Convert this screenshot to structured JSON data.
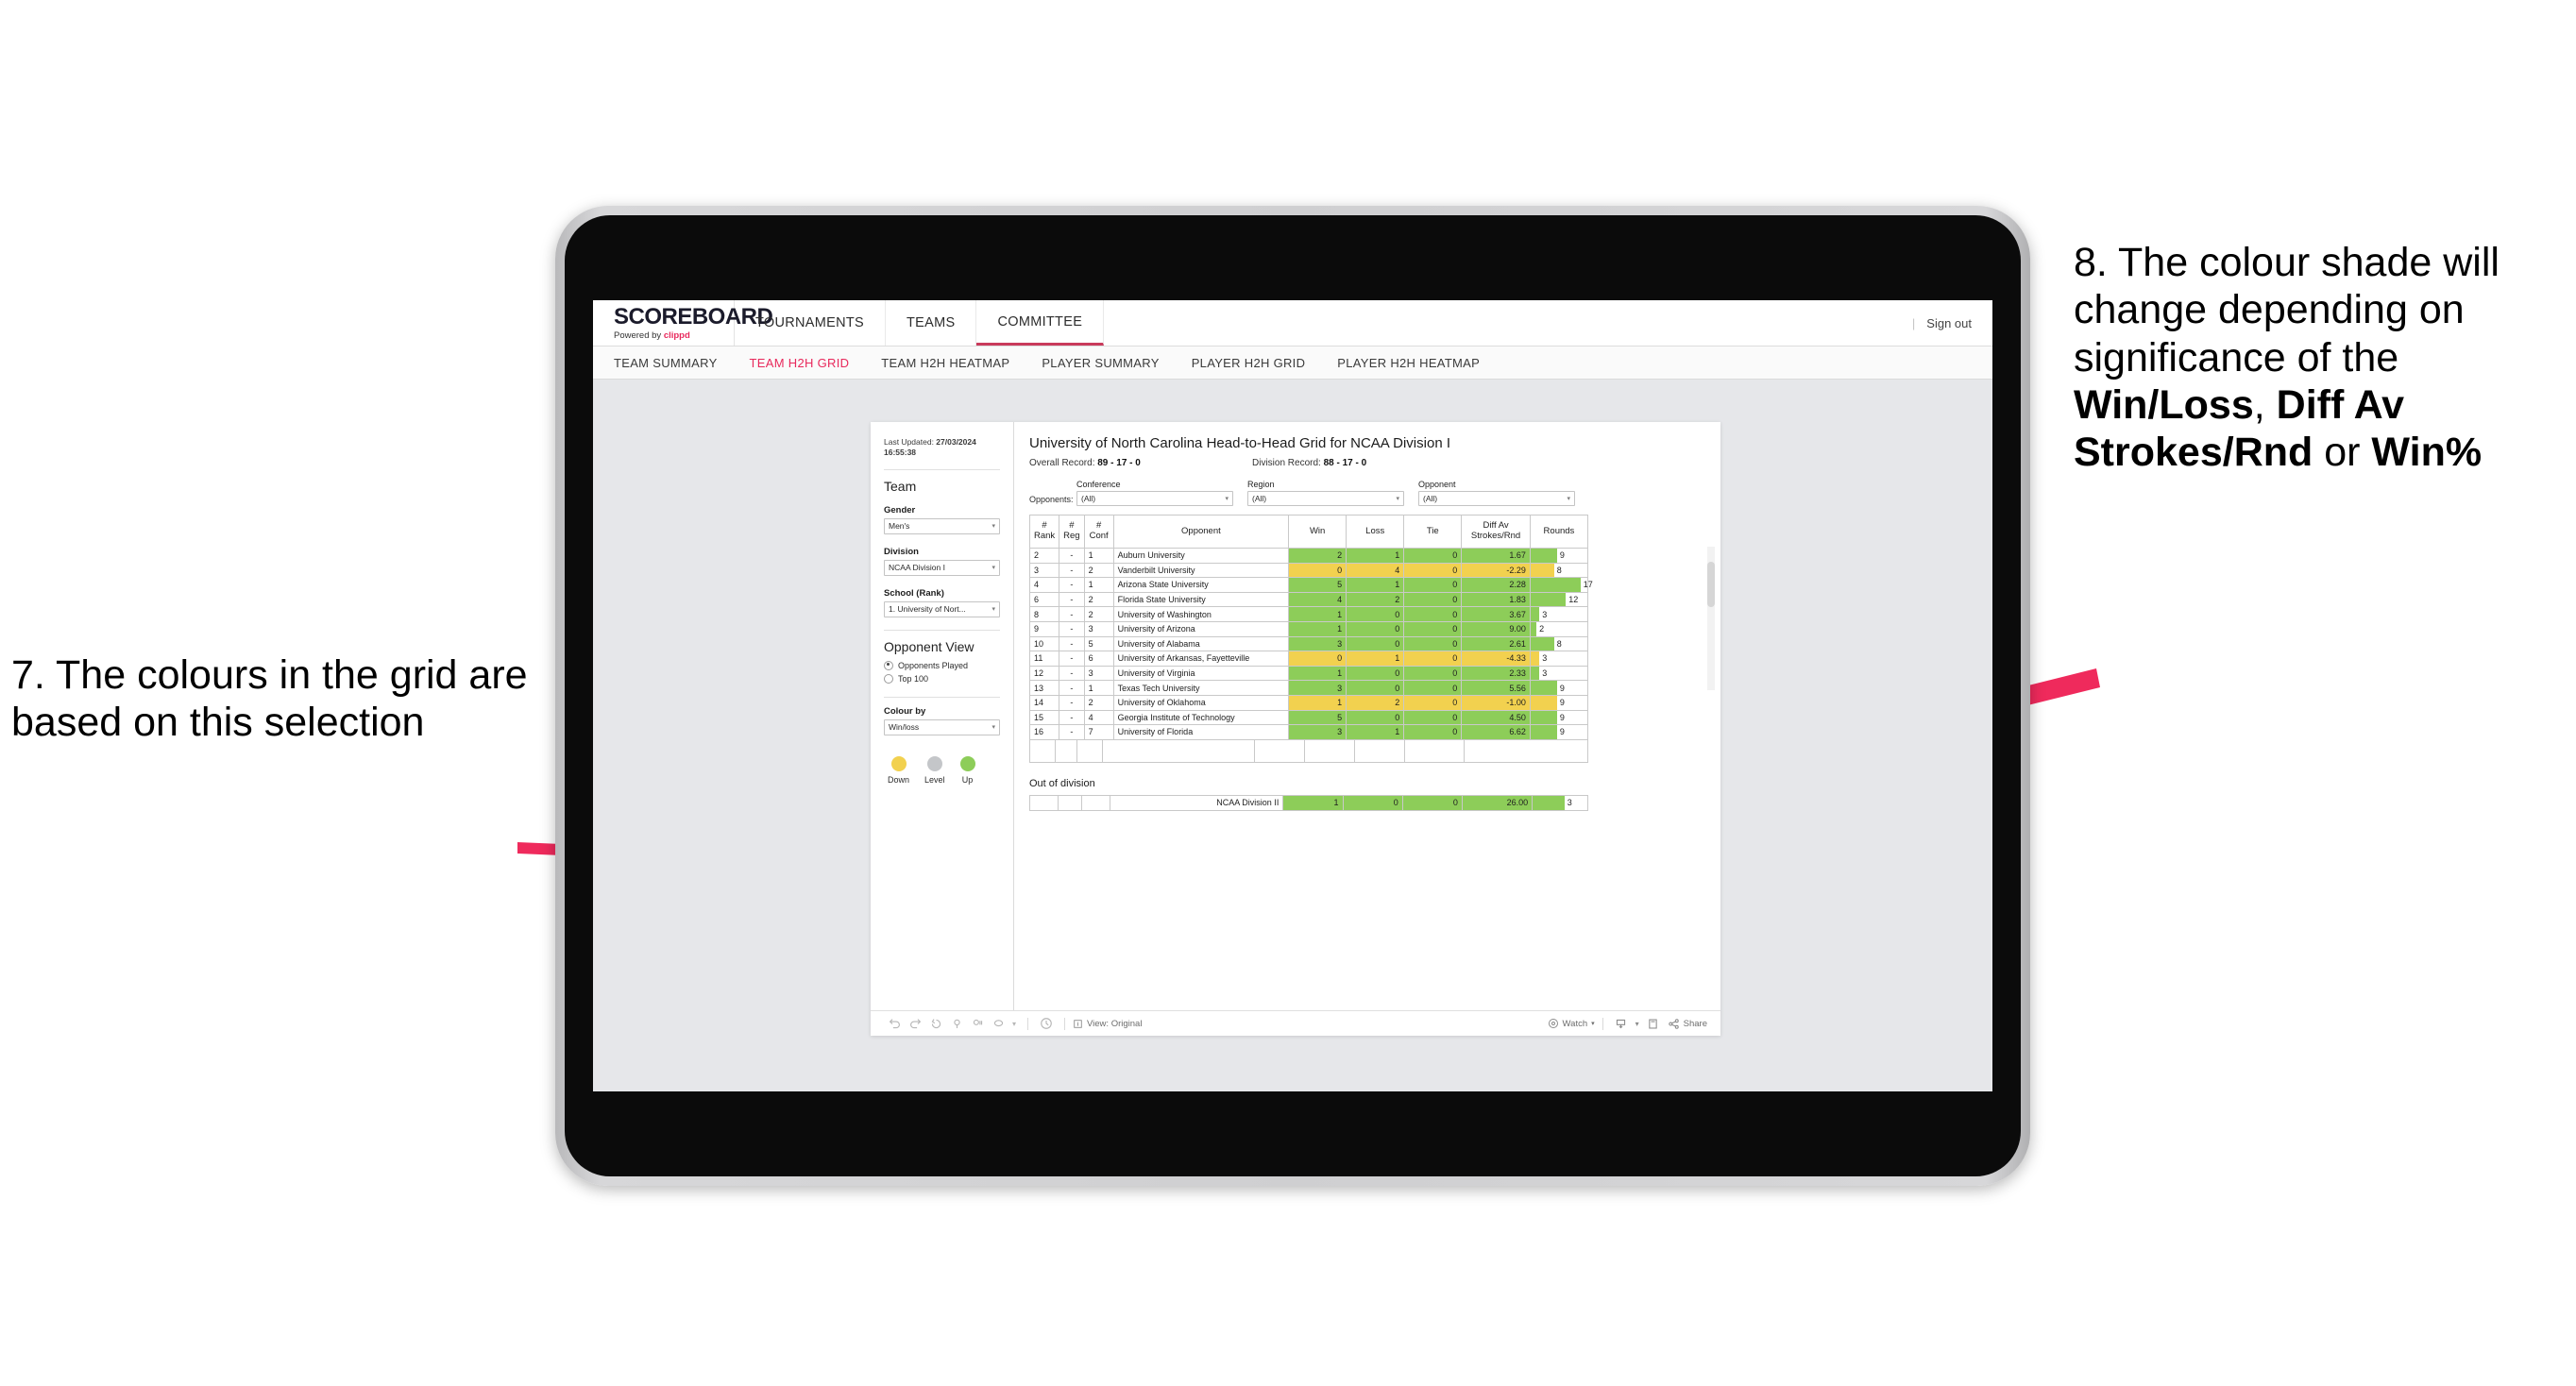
{
  "annotations": {
    "left": {
      "id": "7.",
      "text": "7. The colours in the grid are based on this selection"
    },
    "right": {
      "lead": "8. The colour shade will change depending on significance of the ",
      "bold1": "Win/Loss",
      "mid1": ", ",
      "bold2": "Diff Av Strokes/Rnd",
      "mid2": " or ",
      "bold3": "Win%"
    },
    "arrow_color": "#ef2a5c"
  },
  "app": {
    "logo": "SCOREBOARD",
    "logo_sub_prefix": "Powered by ",
    "logo_brand": "clippd",
    "top_nav": [
      {
        "label": "TOURNAMENTS",
        "active": false
      },
      {
        "label": "TEAMS",
        "active": false
      },
      {
        "label": "COMMITTEE",
        "active": true
      }
    ],
    "sign_out": "Sign out",
    "sub_nav": [
      {
        "label": "TEAM SUMMARY",
        "active": false
      },
      {
        "label": "TEAM H2H GRID",
        "active": true
      },
      {
        "label": "TEAM H2H HEATMAP",
        "active": false
      },
      {
        "label": "PLAYER SUMMARY",
        "active": false
      },
      {
        "label": "PLAYER H2H GRID",
        "active": false
      },
      {
        "label": "PLAYER H2H HEATMAP",
        "active": false
      }
    ],
    "accent": "#e8295c"
  },
  "sidebar": {
    "last_updated_label": "Last Updated: ",
    "last_updated_value": "27/03/2024 16:55:38",
    "team_heading": "Team",
    "gender": {
      "label": "Gender",
      "value": "Men's"
    },
    "division": {
      "label": "Division",
      "value": "NCAA Division I"
    },
    "school": {
      "label": "School (Rank)",
      "value": "1. University of Nort..."
    },
    "opponent_view": {
      "heading": "Opponent View",
      "options": [
        {
          "label": "Opponents Played",
          "selected": true
        },
        {
          "label": "Top 100",
          "selected": false
        }
      ]
    },
    "colour_by": {
      "label": "Colour by",
      "value": "Win/loss"
    },
    "legend": [
      {
        "label": "Down",
        "color": "#f2d14f"
      },
      {
        "label": "Level",
        "color": "#c4c6c9"
      },
      {
        "label": "Up",
        "color": "#8dcd59"
      }
    ]
  },
  "main": {
    "title": "University of North Carolina Head-to-Head Grid for NCAA Division I",
    "overall_record_label": "Overall Record: ",
    "overall_record_value": "89 - 17 - 0",
    "division_record_label": "Division Record: ",
    "division_record_value": "88 - 17 - 0",
    "opponents_label": "Opponents:",
    "filters": [
      {
        "label": "Conference",
        "value": "(All)"
      },
      {
        "label": "Region",
        "value": "(All)"
      },
      {
        "label": "Opponent",
        "value": "(All)"
      }
    ],
    "columns": [
      {
        "l1": "#",
        "l2": "Rank"
      },
      {
        "l1": "#",
        "l2": "Reg"
      },
      {
        "l1": "#",
        "l2": "Conf"
      },
      {
        "l1": "",
        "l2": "Opponent"
      },
      {
        "l1": "",
        "l2": "Win"
      },
      {
        "l1": "",
        "l2": "Loss"
      },
      {
        "l1": "",
        "l2": "Tie"
      },
      {
        "l1": "Diff Av",
        "l2": "Strokes/Rnd"
      },
      {
        "l1": "",
        "l2": "Rounds"
      }
    ],
    "rows": [
      {
        "rank": "2",
        "reg": "-",
        "conf": "1",
        "opponent": "Auburn University",
        "win": "2",
        "loss": "1",
        "tie": "0",
        "diff": "1.67",
        "rounds": "9",
        "state": "up"
      },
      {
        "rank": "3",
        "reg": "-",
        "conf": "2",
        "opponent": "Vanderbilt University",
        "win": "0",
        "loss": "4",
        "tie": "0",
        "diff": "-2.29",
        "rounds": "8",
        "state": "down"
      },
      {
        "rank": "4",
        "reg": "-",
        "conf": "1",
        "opponent": "Arizona State University",
        "win": "5",
        "loss": "1",
        "tie": "0",
        "diff": "2.28",
        "rounds": "17",
        "state": "up"
      },
      {
        "rank": "6",
        "reg": "-",
        "conf": "2",
        "opponent": "Florida State University",
        "win": "4",
        "loss": "2",
        "tie": "0",
        "diff": "1.83",
        "rounds": "12",
        "state": "up"
      },
      {
        "rank": "8",
        "reg": "-",
        "conf": "2",
        "opponent": "University of Washington",
        "win": "1",
        "loss": "0",
        "tie": "0",
        "diff": "3.67",
        "rounds": "3",
        "state": "up"
      },
      {
        "rank": "9",
        "reg": "-",
        "conf": "3",
        "opponent": "University of Arizona",
        "win": "1",
        "loss": "0",
        "tie": "0",
        "diff": "9.00",
        "rounds": "2",
        "state": "up"
      },
      {
        "rank": "10",
        "reg": "-",
        "conf": "5",
        "opponent": "University of Alabama",
        "win": "3",
        "loss": "0",
        "tie": "0",
        "diff": "2.61",
        "rounds": "8",
        "state": "up"
      },
      {
        "rank": "11",
        "reg": "-",
        "conf": "6",
        "opponent": "University of Arkansas, Fayetteville",
        "win": "0",
        "loss": "1",
        "tie": "0",
        "diff": "-4.33",
        "rounds": "3",
        "state": "down"
      },
      {
        "rank": "12",
        "reg": "-",
        "conf": "3",
        "opponent": "University of Virginia",
        "win": "1",
        "loss": "0",
        "tie": "0",
        "diff": "2.33",
        "rounds": "3",
        "state": "up"
      },
      {
        "rank": "13",
        "reg": "-",
        "conf": "1",
        "opponent": "Texas Tech University",
        "win": "3",
        "loss": "0",
        "tie": "0",
        "diff": "5.56",
        "rounds": "9",
        "state": "up"
      },
      {
        "rank": "14",
        "reg": "-",
        "conf": "2",
        "opponent": "University of Oklahoma",
        "win": "1",
        "loss": "2",
        "tie": "0",
        "diff": "-1.00",
        "rounds": "9",
        "state": "down"
      },
      {
        "rank": "15",
        "reg": "-",
        "conf": "4",
        "opponent": "Georgia Institute of Technology",
        "win": "5",
        "loss": "0",
        "tie": "0",
        "diff": "4.50",
        "rounds": "9",
        "state": "up"
      },
      {
        "rank": "16",
        "reg": "-",
        "conf": "7",
        "opponent": "University of Florida",
        "win": "3",
        "loss": "1",
        "tie": "0",
        "diff": "6.62",
        "rounds": "9",
        "state": "up"
      }
    ],
    "out_of_division": {
      "title": "Out of division",
      "row": {
        "opponent": "NCAA Division II",
        "win": "1",
        "loss": "0",
        "tie": "0",
        "diff": "26.00",
        "rounds": "3",
        "state": "up"
      }
    },
    "colors": {
      "up": "#8dcd59",
      "down": "#f2d14f",
      "level": "#c4c6c9"
    }
  },
  "toolbar": {
    "view_label": "View: Original",
    "watch_label": "Watch",
    "share_label": "Share"
  },
  "chart_data": {
    "type": "table",
    "title": "University of North Carolina Head-to-Head Grid for NCAA Division I",
    "columns": [
      "# Rank",
      "# Reg",
      "# Conf",
      "Opponent",
      "Win",
      "Loss",
      "Tie",
      "Diff Av Strokes/Rnd",
      "Rounds"
    ],
    "rows": [
      [
        "2",
        "-",
        "1",
        "Auburn University",
        2,
        1,
        0,
        1.67,
        9
      ],
      [
        "3",
        "-",
        "2",
        "Vanderbilt University",
        0,
        4,
        0,
        -2.29,
        8
      ],
      [
        "4",
        "-",
        "1",
        "Arizona State University",
        5,
        1,
        0,
        2.28,
        17
      ],
      [
        "6",
        "-",
        "2",
        "Florida State University",
        4,
        2,
        0,
        1.83,
        12
      ],
      [
        "8",
        "-",
        "2",
        "University of Washington",
        1,
        0,
        0,
        3.67,
        3
      ],
      [
        "9",
        "-",
        "3",
        "University of Arizona",
        1,
        0,
        0,
        9.0,
        2
      ],
      [
        "10",
        "-",
        "5",
        "University of Alabama",
        3,
        0,
        0,
        2.61,
        8
      ],
      [
        "11",
        "-",
        "6",
        "University of Arkansas, Fayetteville",
        0,
        1,
        0,
        -4.33,
        3
      ],
      [
        "12",
        "-",
        "3",
        "University of Virginia",
        1,
        0,
        0,
        2.33,
        3
      ],
      [
        "13",
        "-",
        "1",
        "Texas Tech University",
        3,
        0,
        0,
        5.56,
        9
      ],
      [
        "14",
        "-",
        "2",
        "University of Oklahoma",
        1,
        2,
        0,
        -1.0,
        9
      ],
      [
        "15",
        "-",
        "4",
        "Georgia Institute of Technology",
        5,
        0,
        0,
        4.5,
        9
      ],
      [
        "16",
        "-",
        "7",
        "University of Florida",
        3,
        1,
        0,
        6.62,
        9
      ],
      [
        "",
        "",
        "",
        "NCAA Division II",
        1,
        0,
        0,
        26.0,
        3
      ]
    ],
    "colour_by": "Win/loss",
    "legend": [
      "Down",
      "Level",
      "Up"
    ]
  }
}
